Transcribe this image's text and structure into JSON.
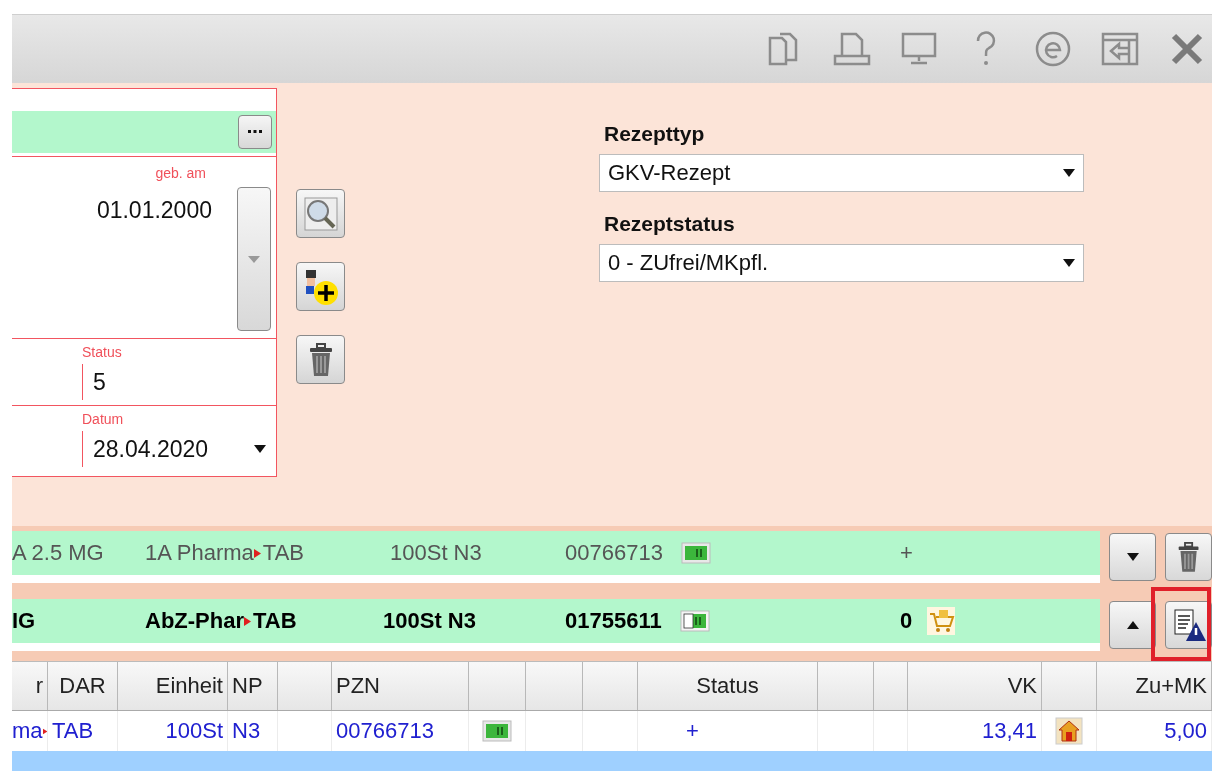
{
  "patient": {
    "birth_date_label": "geb. am",
    "birth_date": "01.01.2000",
    "status_label": "Status",
    "status": "5",
    "date_label": "Datum",
    "date": "28.04.2020"
  },
  "prescription": {
    "type_label": "Rezepttyp",
    "type": "GKV-Rezept",
    "status_label": "Rezeptstatus",
    "status": "0 - ZUfrei/MKpfl."
  },
  "items": [
    {
      "selected": false,
      "name": "A 2.5 MG",
      "maker": "1A Pharma",
      "form": "TAB",
      "pack": "100St N3",
      "pzn": "00766713",
      "mark": "+"
    },
    {
      "selected": true,
      "name": "IG",
      "maker": "AbZ-Phar",
      "form": "TAB",
      "pack": "100St N3",
      "pzn": "01755611",
      "mark": "0"
    }
  ],
  "table": {
    "columns": [
      {
        "label": "r"
      },
      {
        "label": "DAR"
      },
      {
        "label": "Einheit"
      },
      {
        "label": "NP"
      },
      {},
      {
        "label": "PZN"
      },
      {},
      {},
      {},
      {
        "label": "Status"
      },
      {},
      {},
      {
        "label": "VK"
      },
      {},
      {
        "label": "Zu+MK"
      }
    ],
    "rows": [
      {
        "cells": [
          {
            "text": "ma"
          },
          {
            "text": "TAB"
          },
          {
            "text": "100St"
          },
          {
            "text": "N3"
          },
          {},
          {
            "text": "00766713"
          },
          {
            "kind": "card"
          },
          {},
          {},
          {
            "text": "+"
          },
          {},
          {},
          {
            "text": "13,41"
          },
          {
            "kind": "house"
          },
          {
            "text": "5,00"
          }
        ]
      }
    ]
  }
}
